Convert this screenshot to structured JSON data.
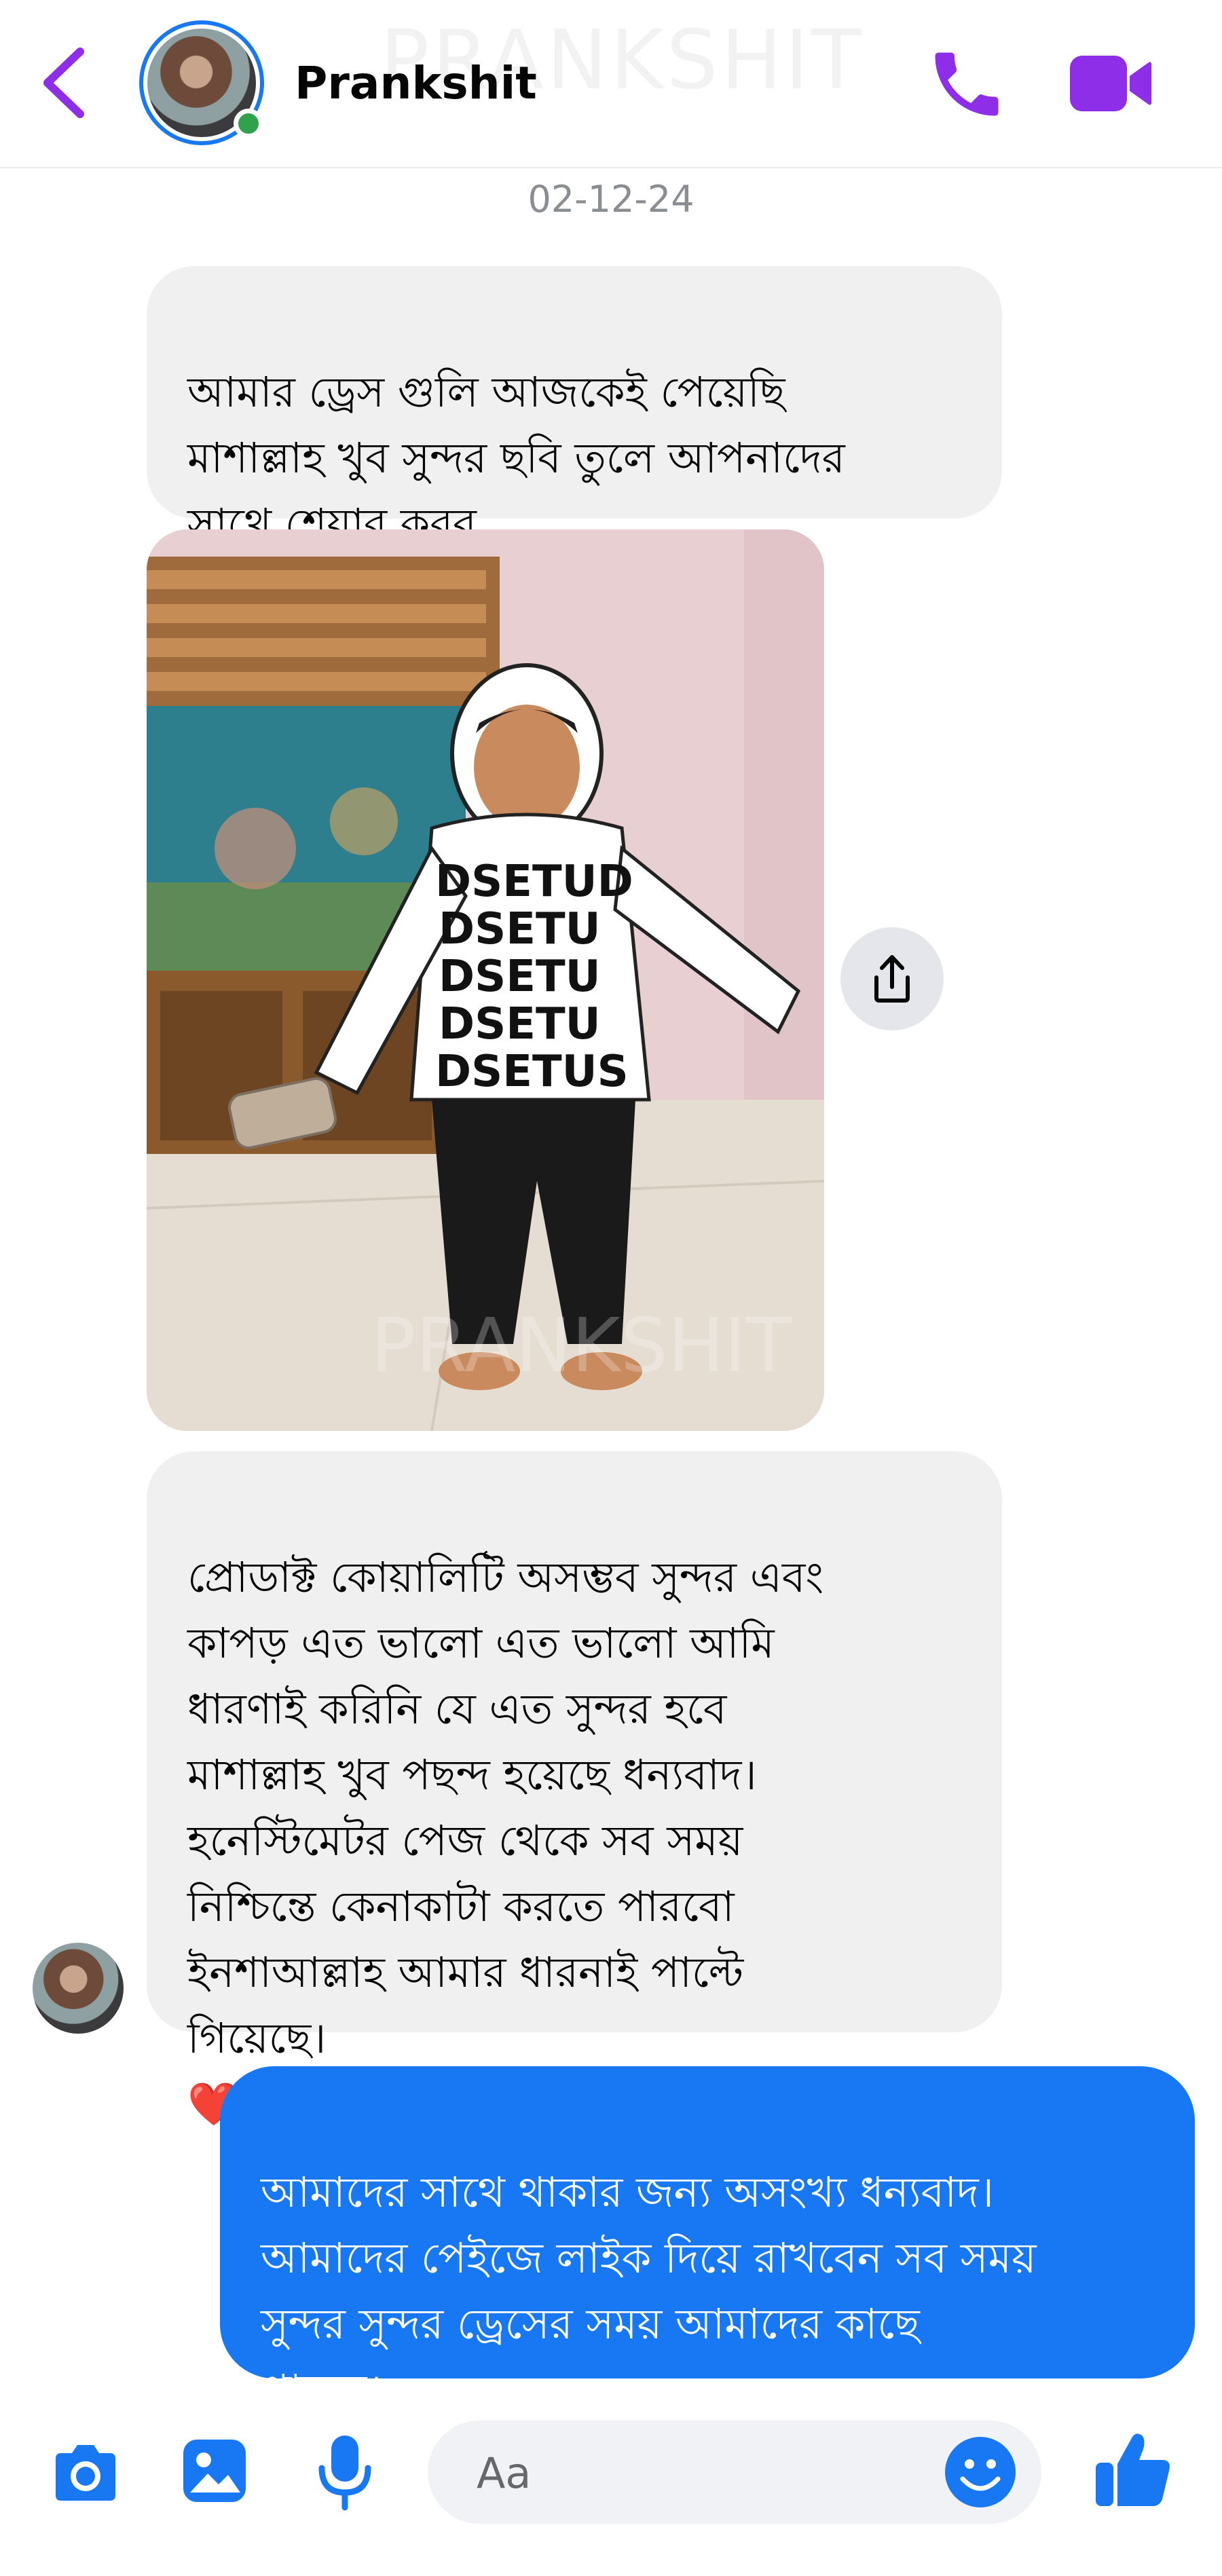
{
  "header": {
    "contact_name": "Prankshit",
    "watermark": "PRANKSHIT",
    "accent_color": "#8e2ee8",
    "online_color": "#31a24c"
  },
  "conversation": {
    "date": "02-12-24",
    "messages": [
      {
        "direction": "incoming",
        "type": "text",
        "text": "আমার ড্রেস গুলি আজকেই পেয়েছি\nমাশাল্লাহ খুব সুন্দর ছবি তুলে আপনাদের\nসাথে শেয়ার করব"
      },
      {
        "direction": "incoming",
        "type": "photo",
        "watermark": "PRANKSHIT",
        "hoodie_letters": [
          "DSETUD",
          "DSETU",
          "DSETU",
          "DSETU",
          "DSETUS"
        ]
      },
      {
        "direction": "incoming",
        "type": "text",
        "text": "প্রোডাক্ট কোয়ালিটি অসম্ভব সুন্দর এবং\nকাপড় এত ভালো এত ভালো আমি\nধারণাই করিনি যে এত সুন্দর হবে\nমাশাল্লাহ খুব পছন্দ হয়েছে ধন্যবাদ।\nহনেস্টিমেটর পেজ থেকে সব সময়\nনিশ্চিন্তে কেনাকাটা করতে পারবো\nইনশাআল্লাহ আমার ধারনাই পাল্টে\nগিয়েছে।",
        "emoji": "❤️❤️"
      },
      {
        "direction": "outgoing",
        "type": "text",
        "text": "আমাদের সাথে থাকার জন্য অসংখ্য ধন্যবাদ।\nআমাদের পেইজে লাইক দিয়ে রাখবেন সব সময়\nসুন্দর সুন্দর ড্রেসের সময় আমাদের কাছে\nপাবেন।"
      }
    ]
  },
  "composer": {
    "placeholder": "Aa",
    "icon_color": "#1877f2",
    "icons": [
      "camera-icon",
      "gallery-icon",
      "microphone-icon",
      "emoji-icon",
      "thumbs-up-icon"
    ]
  },
  "colors": {
    "incoming_bubble": "#f0f0f0",
    "outgoing_bubble": "#1877f2"
  }
}
